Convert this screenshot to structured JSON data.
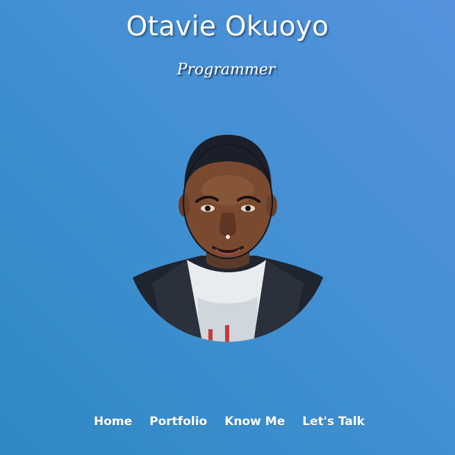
{
  "header": {
    "name": "Otavie Okuoyo",
    "role": "Programmer"
  },
  "avatar": {
    "icon": "person-portrait"
  },
  "nav": {
    "items": [
      {
        "label": "Home"
      },
      {
        "label": "Portfolio"
      },
      {
        "label": "Know Me"
      },
      {
        "label": "Let's Talk"
      }
    ]
  },
  "colors": {
    "background_start": "#2f88c3",
    "background_end": "#5592dd",
    "text": "#ffffff"
  }
}
